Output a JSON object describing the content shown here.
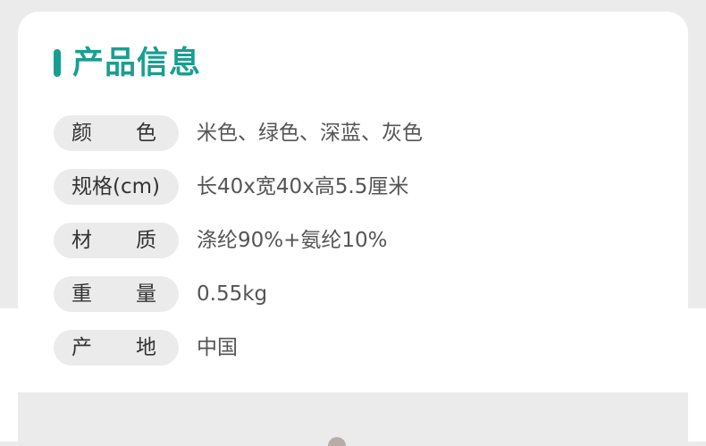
{
  "section": {
    "title": "产品信息"
  },
  "specs": {
    "color": {
      "label_first": "颜",
      "label_second": "色",
      "value": "米色、绿色、深蓝、灰色"
    },
    "size": {
      "label": "规格(cm)",
      "value": "长40x宽40x高5.5厘米"
    },
    "material": {
      "label_first": "材",
      "label_second": "质",
      "value": "涤纶90%+氨纶10%"
    },
    "weight": {
      "label_first": "重",
      "label_second": "量",
      "value": "0.55kg"
    },
    "origin": {
      "label_first": "产",
      "label_second": "地",
      "value": "中国"
    }
  }
}
